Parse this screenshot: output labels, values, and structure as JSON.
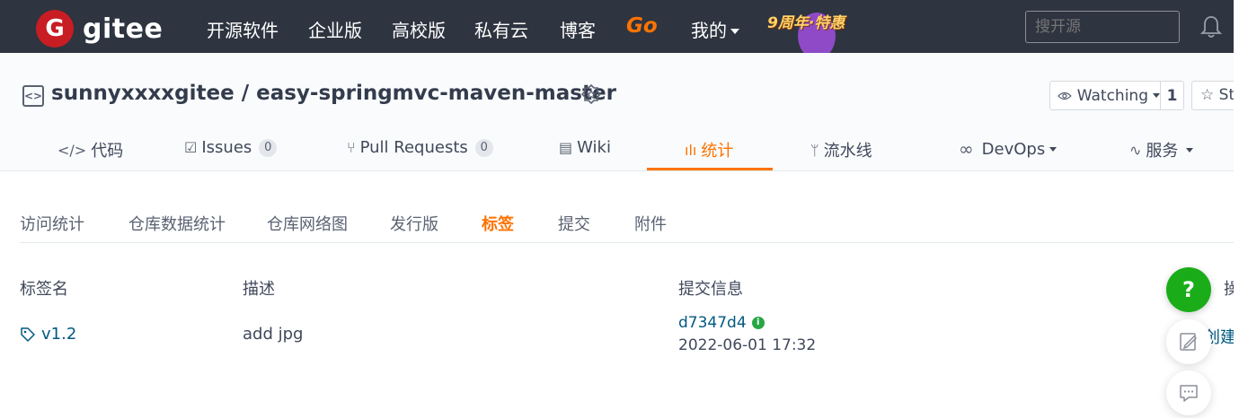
{
  "topnav": {
    "logo_letter": "G",
    "logo_text": "gitee",
    "items": [
      "开源软件",
      "企业版",
      "高校版",
      "私有云",
      "博客"
    ],
    "go_label": "Go",
    "mine_label": "我的",
    "promo_label": "9周年·特惠",
    "search_placeholder": "搜开源",
    "bell_icon": "bell-icon"
  },
  "repo": {
    "icon_text": "<>",
    "title": "sunnyxxxxgitee / easy-springmvc-maven-master",
    "watch_label": "Watching",
    "watch_count": "1",
    "star_label": "St"
  },
  "tabs": [
    {
      "icon": "</>",
      "label": "代码"
    },
    {
      "icon": "☑",
      "label": "Issues",
      "count": "0"
    },
    {
      "icon": "⑂",
      "label": "Pull Requests",
      "count": "0"
    },
    {
      "icon": "▤",
      "label": "Wiki"
    },
    {
      "icon": "ılı",
      "label": "统计"
    },
    {
      "icon": "ᛘ",
      "label": "流水线"
    },
    {
      "icon": "∞",
      "label": "DevOps"
    },
    {
      "icon": "∿",
      "label": "服务"
    }
  ],
  "subtabs": [
    "访问统计",
    "仓库数据统计",
    "仓库网络图",
    "发行版",
    "标签",
    "提交",
    "附件"
  ],
  "table": {
    "headers": {
      "name": "标签名",
      "desc": "描述",
      "commit": "提交信息",
      "extra": "操"
    },
    "rows": [
      {
        "name": "v1.2",
        "desc": "add jpg",
        "sha": "d7347d4",
        "date": "2022-06-01 17:32",
        "extra": "创建"
      }
    ]
  },
  "floating": {
    "help": "?"
  },
  "colors": {
    "accent": "#fe7300",
    "nav_bg": "#2e3440",
    "link": "#005980",
    "brand": "#c71d23"
  }
}
